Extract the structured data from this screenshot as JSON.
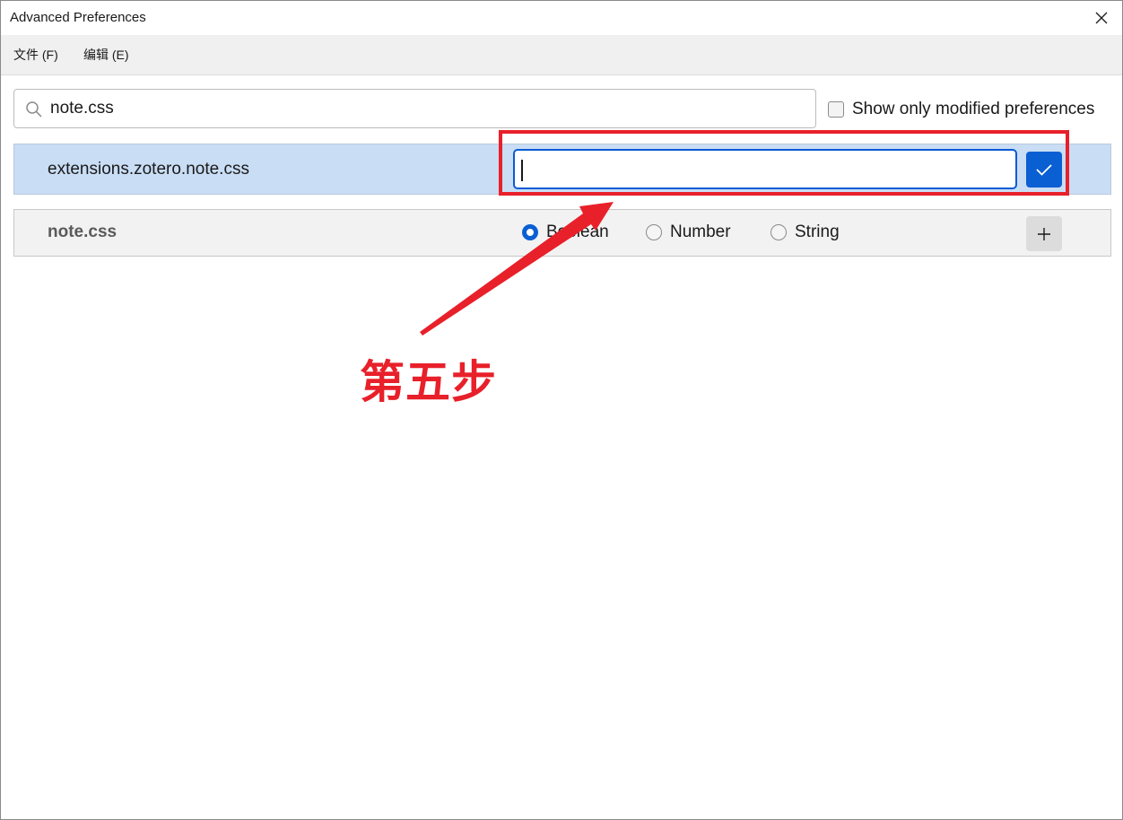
{
  "window": {
    "title": "Advanced Preferences"
  },
  "menubar": {
    "file_label": "文件 (F)",
    "edit_label": "编辑 (E)"
  },
  "search": {
    "value": "note.css",
    "show_modified_label": "Show only modified preferences",
    "show_modified_checked": false
  },
  "pref_row": {
    "name": "extensions.zotero.note.css",
    "value": ""
  },
  "new_pref": {
    "name": "note.css",
    "types": [
      {
        "label": "Boolean",
        "checked": true
      },
      {
        "label": "Number",
        "checked": false
      },
      {
        "label": "String",
        "checked": false
      }
    ]
  },
  "annotation": {
    "text": "第五步",
    "color": "#e8202a"
  },
  "colors": {
    "accent": "#0a5fd3",
    "selected_row": "#c9ddf5"
  },
  "icons": {
    "close": "close-icon",
    "search": "search-icon",
    "save": "checkmark-icon",
    "add": "plus-icon"
  }
}
